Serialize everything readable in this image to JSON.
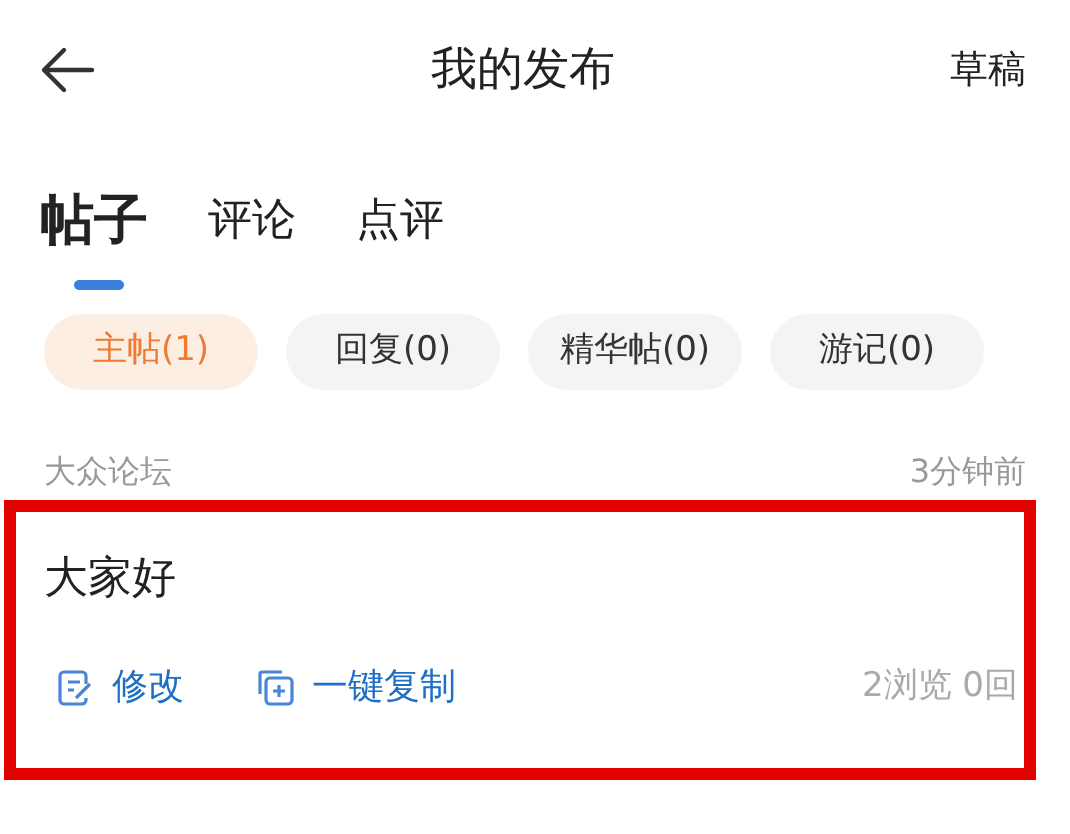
{
  "header": {
    "title": "我的发布",
    "action": "草稿"
  },
  "tabs": [
    {
      "label": "帖子",
      "selected": true
    },
    {
      "label": "评论",
      "selected": false
    },
    {
      "label": "点评",
      "selected": false
    }
  ],
  "filters": [
    {
      "label": "主帖(1)",
      "selected": true
    },
    {
      "label": "回复(0)",
      "selected": false
    },
    {
      "label": "精华帖(0)",
      "selected": false
    },
    {
      "label": "游记(0)",
      "selected": false
    }
  ],
  "post": {
    "forum": "大众论坛",
    "time": "3分钟前",
    "title": "大家好",
    "actions": [
      {
        "kind": "edit",
        "label": "修改"
      },
      {
        "kind": "copy",
        "label": "一键复制"
      }
    ],
    "stats": "2浏览 0回",
    "highlighted": true
  }
}
